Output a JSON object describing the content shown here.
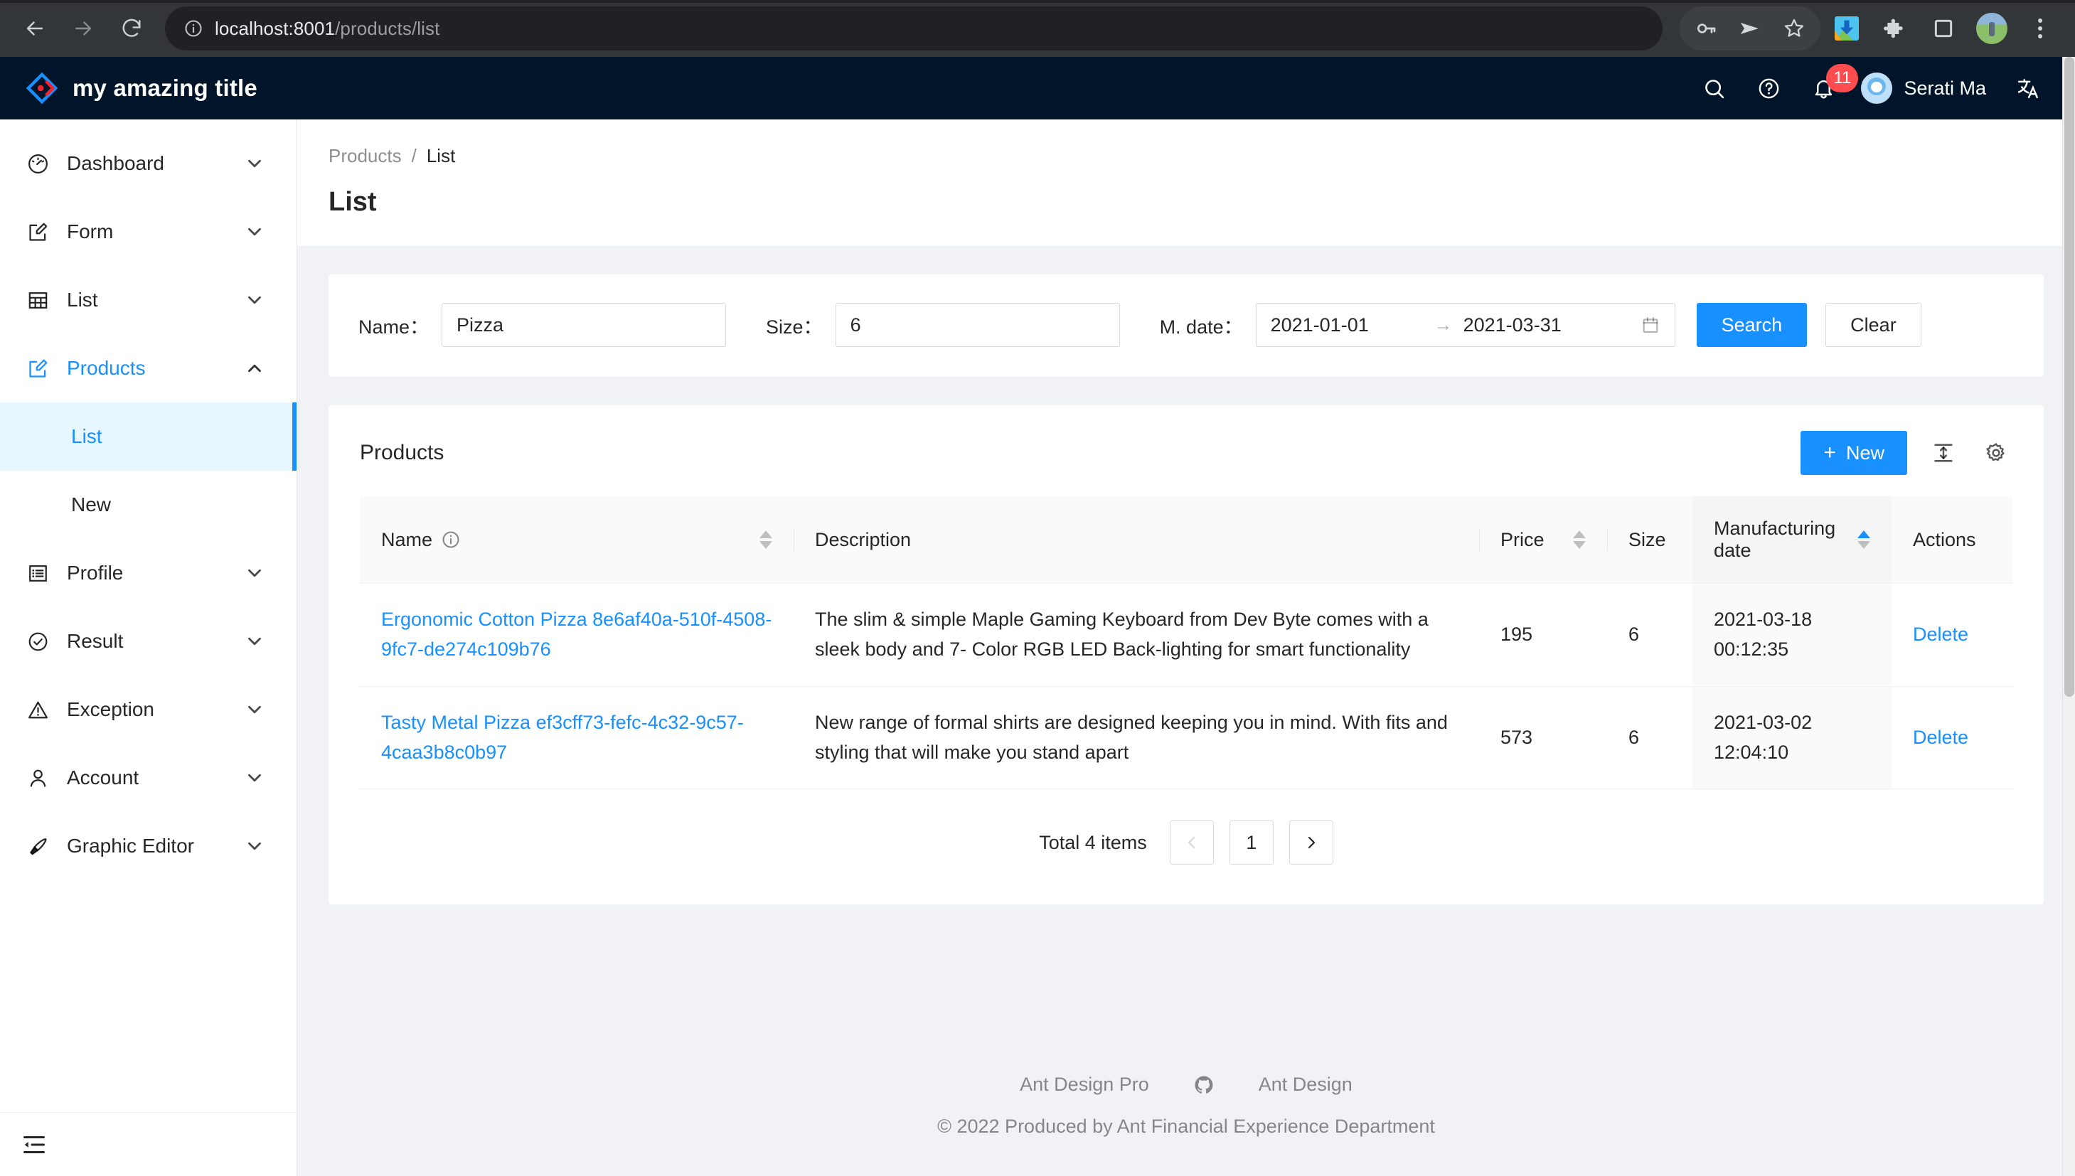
{
  "browser": {
    "url_host": "localhost:8001",
    "url_path": "/products/list",
    "back_icon": "back-arrow-icon",
    "forward_icon": "forward-arrow-icon",
    "reload_icon": "reload-icon",
    "site_info_icon": "site-info-icon",
    "toolbar_icons": [
      "password-key-icon",
      "send-icon",
      "bookmark-star-icon",
      "download-icon",
      "extensions-puzzle-icon",
      "side-panel-icon",
      "profile-avatar-icon",
      "chrome-menu-icon"
    ]
  },
  "header": {
    "title": "my amazing title",
    "logo_icon": "diamond-logo-icon",
    "search_icon": "search-icon",
    "help_icon": "question-circle-icon",
    "bell_icon": "bell-icon",
    "notification_count": "11",
    "user_name": "Serati Ma",
    "avatar_icon": "user-avatar",
    "translate_icon": "translate-icon"
  },
  "sidebar": {
    "items": [
      {
        "label": "Dashboard",
        "icon": "dashboard-icon",
        "chevron": "chevron-down-icon",
        "state": "collapsed"
      },
      {
        "label": "Form",
        "icon": "form-edit-icon",
        "chevron": "chevron-down-icon",
        "state": "collapsed"
      },
      {
        "label": "List",
        "icon": "table-icon",
        "chevron": "chevron-down-icon",
        "state": "collapsed"
      },
      {
        "label": "Products",
        "icon": "form-edit-icon",
        "chevron": "chevron-up-icon",
        "state": "expanded",
        "active": true
      },
      {
        "label": "Profile",
        "icon": "profile-icon",
        "chevron": "chevron-down-icon",
        "state": "collapsed"
      },
      {
        "label": "Result",
        "icon": "check-circle-icon",
        "chevron": "chevron-down-icon",
        "state": "collapsed"
      },
      {
        "label": "Exception",
        "icon": "warning-triangle-icon",
        "chevron": "chevron-down-icon",
        "state": "collapsed"
      },
      {
        "label": "Account",
        "icon": "user-icon",
        "chevron": "chevron-down-icon",
        "state": "collapsed"
      },
      {
        "label": "Graphic Editor",
        "icon": "highlighter-icon",
        "chevron": "chevron-down-icon",
        "state": "collapsed"
      }
    ],
    "submenu": [
      {
        "label": "List",
        "selected": true
      },
      {
        "label": "New",
        "selected": false
      }
    ],
    "collapse_icon": "menu-fold-icon"
  },
  "page": {
    "breadcrumb": {
      "parent": "Products",
      "separator": "/",
      "current": "List"
    },
    "title": "List"
  },
  "filter": {
    "name_label": "Name：",
    "name_value": "Pizza",
    "size_label": "Size：",
    "size_value": "6",
    "date_label": "M. date：",
    "date_start": "2021-01-01",
    "date_separator": "→",
    "date_end": "2021-03-31",
    "calendar_icon": "calendar-icon",
    "search_button": "Search",
    "clear_button": "Clear"
  },
  "table": {
    "title": "Products",
    "new_button": "New",
    "new_icon": "plus-icon",
    "density_icon": "column-height-icon",
    "settings_icon": "gear-icon",
    "columns": [
      {
        "label": "Name",
        "info_icon": "info-circle-icon",
        "sortable": true,
        "sort_state": "none"
      },
      {
        "label": "Description",
        "sortable": false
      },
      {
        "label": "Price",
        "sortable": true,
        "sort_state": "none"
      },
      {
        "label": "Size",
        "sortable": false
      },
      {
        "label": "Manufacturing date",
        "sortable": true,
        "sort_state": "ascend"
      },
      {
        "label": "Actions",
        "sortable": false
      }
    ],
    "rows": [
      {
        "name": "Ergonomic Cotton Pizza 8e6af40a-510f-4508-9fc7-de274c109b76",
        "description": "The slim & simple Maple Gaming Keyboard from Dev Byte comes with a sleek body and 7- Color RGB LED Back-lighting for smart functionality",
        "price": "195",
        "size": "6",
        "manufacturing_date": "2021-03-18 00:12:35",
        "action": "Delete"
      },
      {
        "name": "Tasty Metal Pizza ef3cff73-fefc-4c32-9c57-4caa3b8c0b97",
        "description": "New range of formal shirts are designed keeping you in mind. With fits and styling that will make you stand apart",
        "price": "573",
        "size": "6",
        "manufacturing_date": "2021-03-02 12:04:10",
        "action": "Delete"
      }
    ],
    "pagination": {
      "total_text": "Total 4 items",
      "prev_icon": "chevron-left-icon",
      "current_page": "1",
      "next_icon": "chevron-right-icon"
    }
  },
  "footer": {
    "link1": "Ant Design Pro",
    "github_icon": "github-icon",
    "link2": "Ant Design",
    "copyright": "© 2022 Produced by Ant Financial Experience Department"
  },
  "colors": {
    "primary": "#1890ff",
    "header_bg": "#001529",
    "badge": "#ff4d4f",
    "page_bg": "#f0f2f5"
  }
}
